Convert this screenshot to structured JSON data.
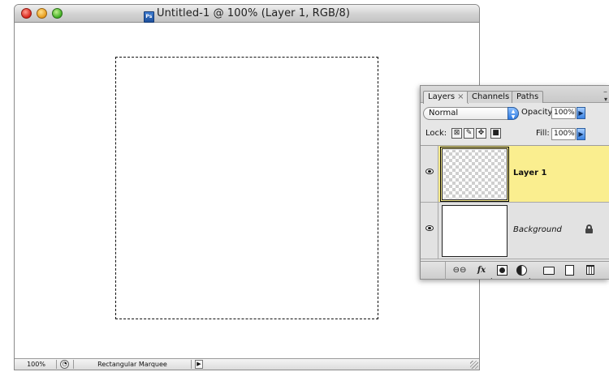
{
  "document_window": {
    "title": "Untitled-1 @ 100% (Layer 1, RGB/8)",
    "ps_badge": "Ps",
    "status": {
      "zoom": "100%",
      "tool": "Rectangular Marquee"
    }
  },
  "layers_palette": {
    "tabs": [
      {
        "label": "Layers",
        "close": "×",
        "active": true
      },
      {
        "label": "Channels",
        "active": false
      },
      {
        "label": "Paths",
        "active": false
      }
    ],
    "blend_mode": "Normal",
    "opacity_label": "Opacity:",
    "opacity_value": "100%",
    "lock_label": "Lock:",
    "fill_label": "Fill:",
    "fill_value": "100%",
    "layers": [
      {
        "name": "Layer 1",
        "selected": true,
        "transparent": true,
        "visible": true
      },
      {
        "name": "Background",
        "selected": false,
        "transparent": false,
        "visible": true,
        "locked": true
      }
    ],
    "bottom_buttons": [
      "link-layers",
      "layer-style",
      "layer-mask",
      "adjustment-layer",
      "new-group",
      "new-layer",
      "delete-layer"
    ],
    "fx_label": "fx"
  },
  "colors": {
    "selected_layer": "#faee8f",
    "panel_bg": "#e6e6e6",
    "accent_blue": "#3a82e3"
  }
}
